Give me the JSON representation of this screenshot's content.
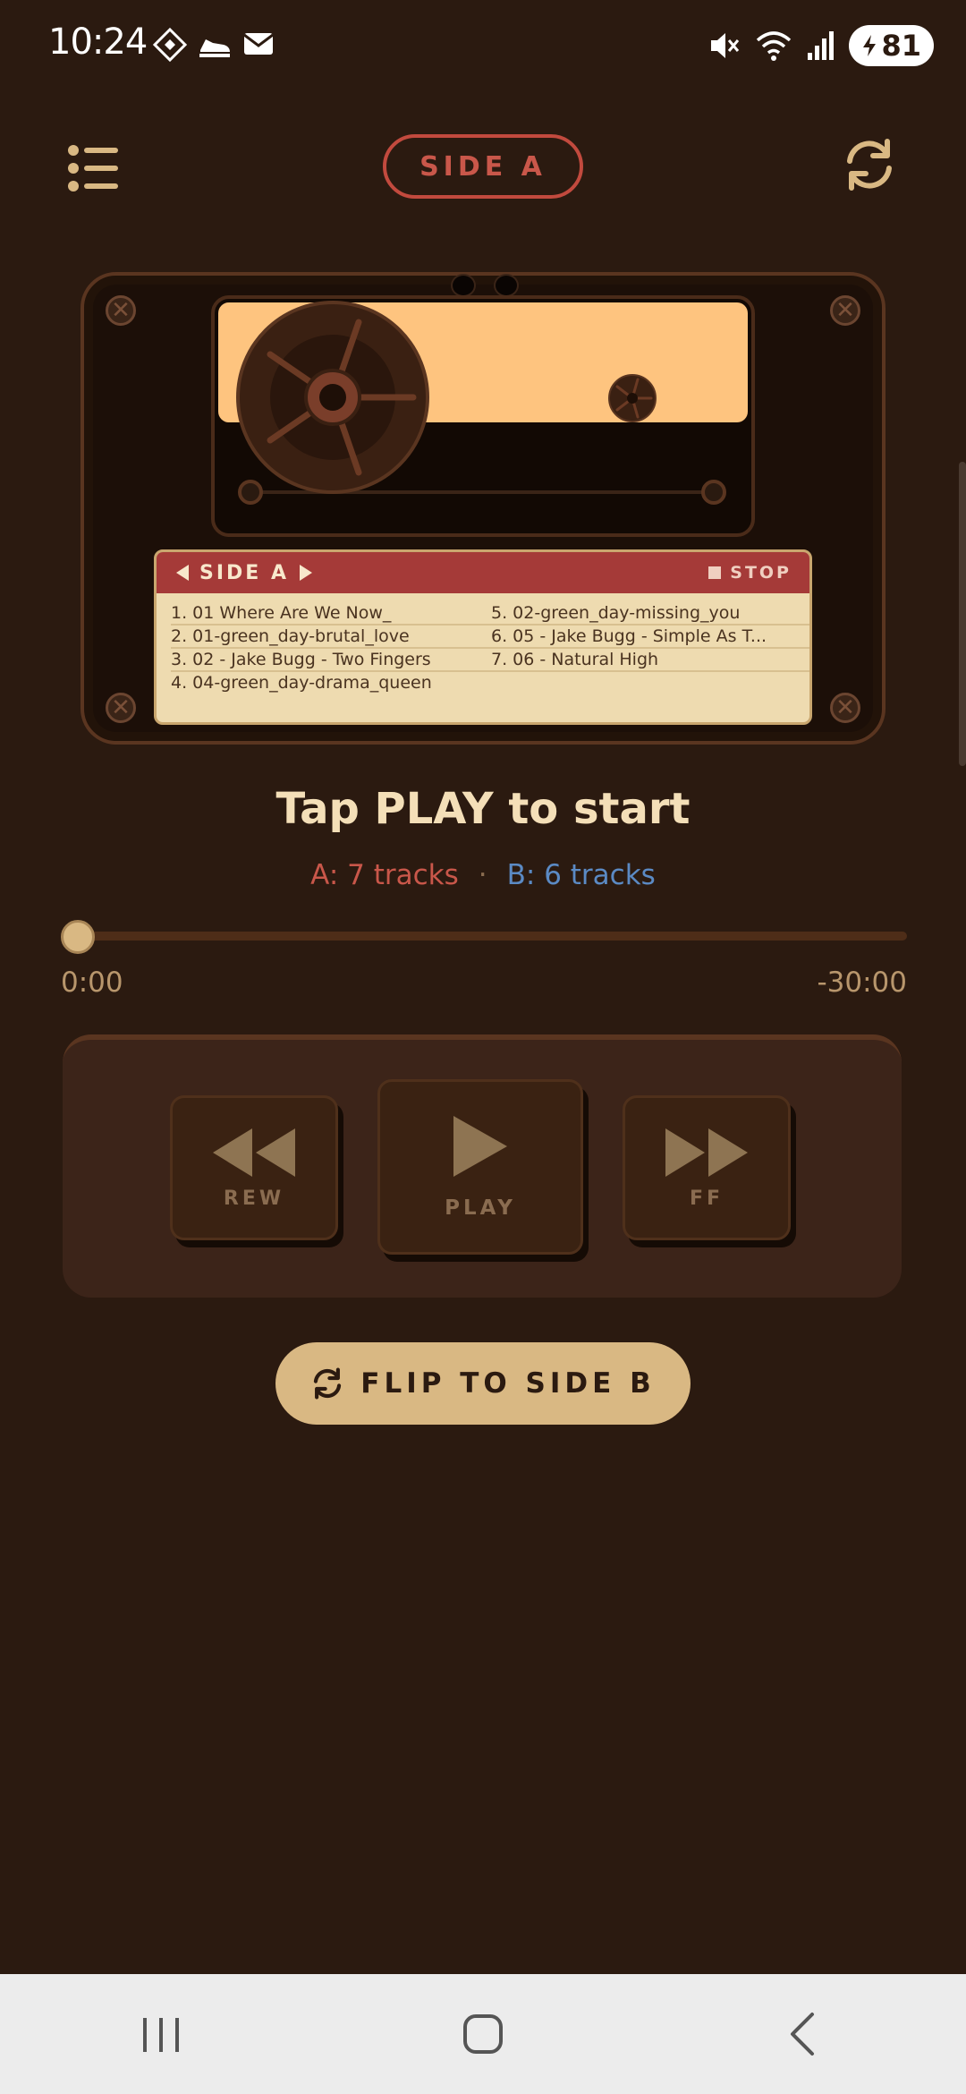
{
  "status_bar": {
    "time": "10:24",
    "battery": "81"
  },
  "header": {
    "side_label": "SIDE A"
  },
  "cassette": {
    "label_side": "SIDE A",
    "stop_label": "STOP",
    "tracks": [
      "1. 01 Where Are We Now_",
      "5. 02-green_day-missing_you",
      "2. 01-green_day-brutal_love",
      "6. 05 - Jake Bugg - Simple As T...",
      "3. 02 - Jake Bugg - Two Fingers",
      "7. 06 - Natural High",
      "4. 04-green_day-drama_queen",
      ""
    ]
  },
  "player": {
    "title": "Tap PLAY to start",
    "count_a": "A: 7 tracks",
    "separator": "·",
    "count_b": "B: 6 tracks",
    "time_elapsed": "0:00",
    "time_remaining": "-30:00",
    "progress": 0
  },
  "transport": {
    "rew_label": "REW",
    "play_label": "PLAY",
    "ff_label": "FF"
  },
  "flip_button": {
    "label": "FLIP TO SIDE B"
  },
  "colors": {
    "background": "#2b1a10",
    "accent_red": "#c24a3e",
    "accent_blue": "#5b8ac4",
    "cream": "#d9b883",
    "tape": "#fec47f"
  }
}
